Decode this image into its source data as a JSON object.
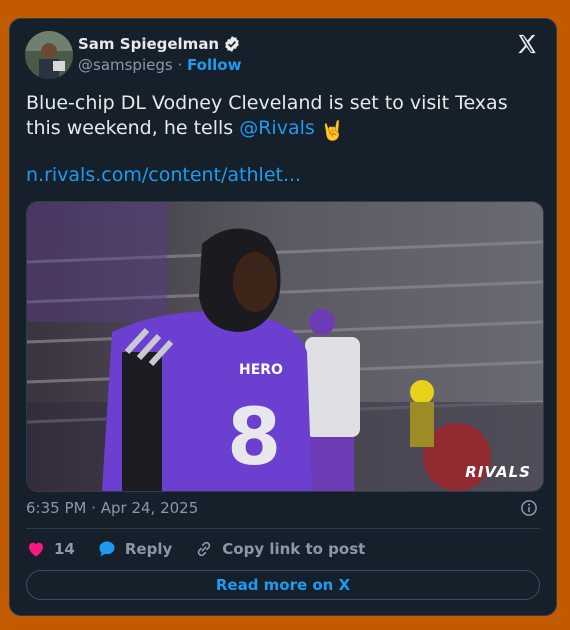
{
  "author": {
    "name": "Sam Spiegelman",
    "handle": "@samspiegs",
    "separator": "·",
    "follow_label": "Follow"
  },
  "tweet": {
    "text_main": "Blue-chip DL Vodney Cleveland is set to visit Texas this weekend, he tells ",
    "mention": "@Rivals",
    "emoji": "🤘",
    "link": "n.rivals.com/content/athlet..."
  },
  "media": {
    "alt": "Football player in purple HERO jersey number 8",
    "jersey_text": "HERO",
    "jersey_number": "8",
    "watermark": "RIVALS"
  },
  "meta": {
    "timestamp": "6:35 PM · Apr 24, 2025"
  },
  "actions": {
    "like_count": "14",
    "reply_label": "Reply",
    "copy_label": "Copy link to post"
  },
  "read_more_label": "Read more on X",
  "colors": {
    "background": "#c25b00",
    "card": "#15202b",
    "accent": "#1d9bf0",
    "like": "#f91880"
  },
  "icons": [
    "verified-badge-icon",
    "x-logo-icon",
    "info-icon",
    "heart-icon",
    "reply-bubble-icon",
    "link-icon"
  ]
}
